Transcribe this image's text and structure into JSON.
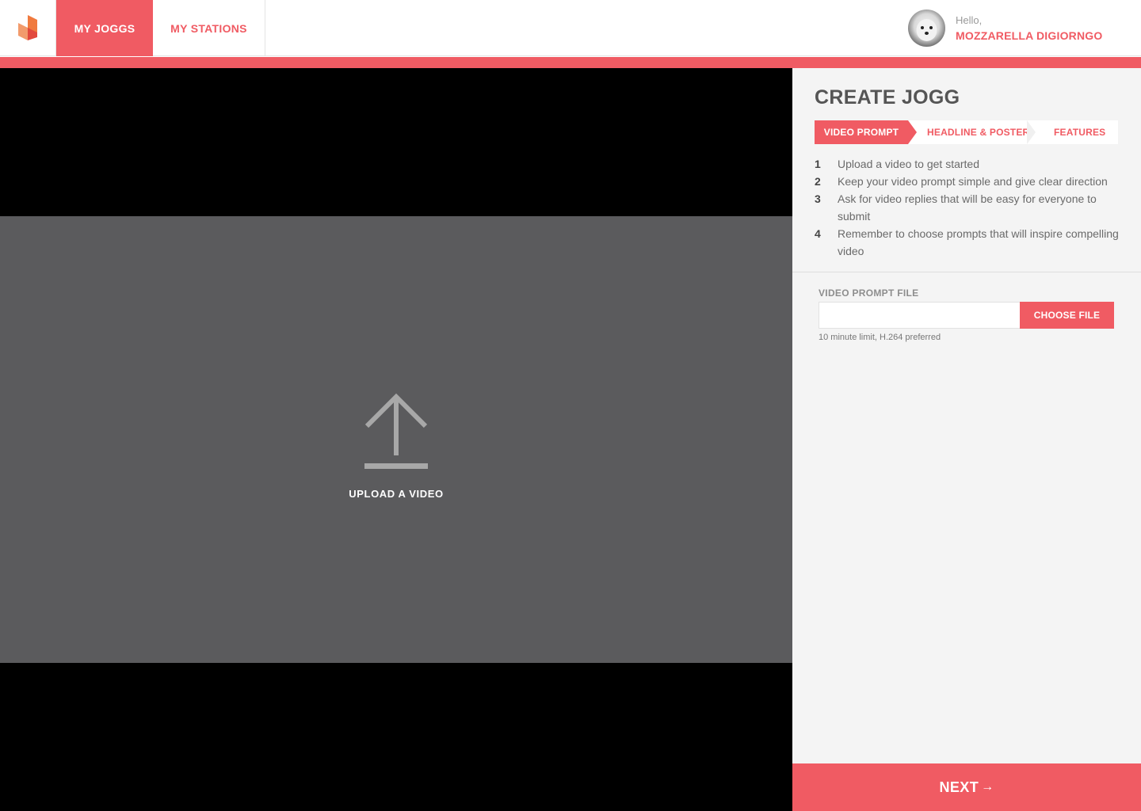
{
  "header": {
    "logo_icon": "jogg-logo-icon",
    "tabs": [
      {
        "label": "MY JOGGS",
        "active": true
      },
      {
        "label": "MY STATIONS",
        "active": false
      }
    ],
    "user": {
      "greeting": "Hello,",
      "name": "MOZZARELLA DIGIORNGO",
      "avatar_icon": "dog-avatar"
    }
  },
  "video": {
    "upload_icon": "upload-arrow-icon",
    "upload_label": "UPLOAD A VIDEO"
  },
  "panel": {
    "title": "CREATE JOGG",
    "steps": [
      "VIDEO PROMPT",
      "HEADLINE & POSTER",
      "FEATURES"
    ],
    "active_step": 0,
    "instructions": [
      {
        "num": "1",
        "text": "Upload a video to get started"
      },
      {
        "num": "2",
        "text": "Keep your video prompt simple and give clear direction"
      },
      {
        "num": "3",
        "text": "Ask for video replies that will be easy for everyone to submit"
      },
      {
        "num": "4",
        "text": "Remember to choose prompts that will inspire compelling video"
      }
    ],
    "file": {
      "label": "VIDEO PROMPT FILE",
      "value": "",
      "button": "CHOOSE FILE",
      "hint": "10 minute limit, H.264 preferred"
    },
    "next": {
      "label": "NEXT",
      "arrow": "→"
    }
  },
  "colors": {
    "accent": "#f05b63",
    "panel_bg": "#f4f4f4",
    "upload_bg": "#5b5b5d"
  }
}
